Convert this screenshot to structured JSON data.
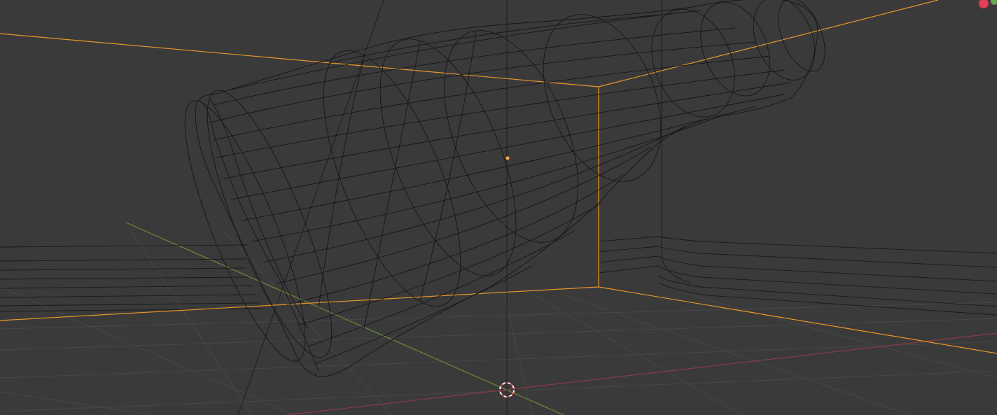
{
  "viewport": {
    "background": "#3a3a3a",
    "colors": {
      "grid": "#4a4a4a",
      "x_axis": "#8a3a48",
      "y_axis": "#6b8a3a",
      "selection": "#e8962a",
      "wire": "#141414",
      "origin": "#ffa64d",
      "cursor_red": "#d94c4c",
      "cursor_white": "#ffffff",
      "gizmo_red": "#e0405a",
      "gizmo_green": "#6aa84f"
    },
    "icons": {
      "cursor": "3d-cursor-icon",
      "origin": "object-origin-icon",
      "gizmo": "navigation-gizmo-icon"
    }
  }
}
